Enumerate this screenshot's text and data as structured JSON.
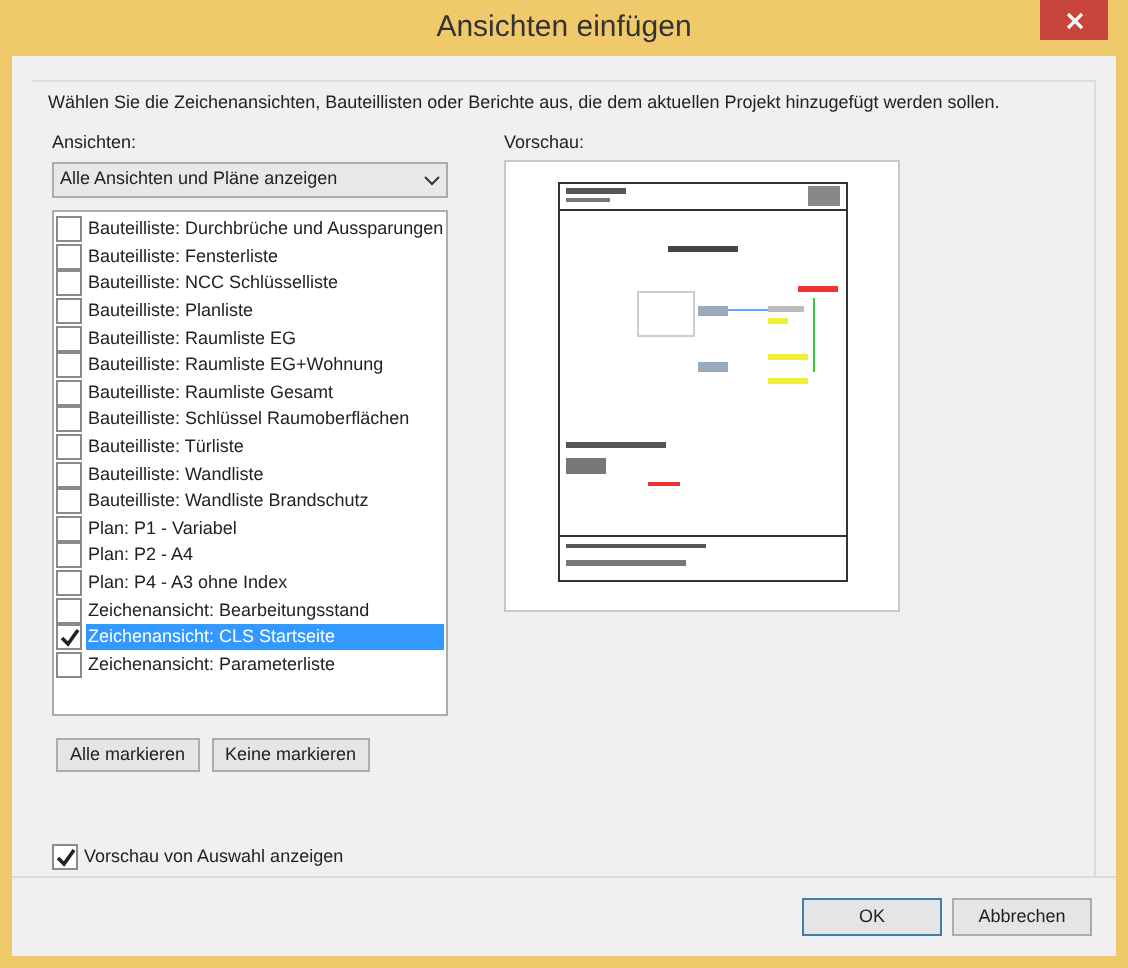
{
  "window": {
    "title": "Ansichten einfügen"
  },
  "instruction": "Wählen Sie die Zeichenansichten, Bauteillisten oder Berichte aus, die dem aktuellen Projekt hinzugefügt werden sollen.",
  "views_label": "Ansichten:",
  "filter": {
    "value": "Alle Ansichten und Pläne anzeigen"
  },
  "items": [
    {
      "label": "Bauteilliste: Durchbrüche und Aussparungen",
      "checked": false,
      "selected": false
    },
    {
      "label": "Bauteilliste: Fensterliste",
      "checked": false,
      "selected": false
    },
    {
      "label": "Bauteilliste: NCC Schlüsselliste",
      "checked": false,
      "selected": false
    },
    {
      "label": "Bauteilliste: Planliste",
      "checked": false,
      "selected": false
    },
    {
      "label": "Bauteilliste: Raumliste EG",
      "checked": false,
      "selected": false
    },
    {
      "label": "Bauteilliste: Raumliste EG+Wohnung",
      "checked": false,
      "selected": false
    },
    {
      "label": "Bauteilliste: Raumliste Gesamt",
      "checked": false,
      "selected": false
    },
    {
      "label": "Bauteilliste: Schlüssel Raumoberflächen",
      "checked": false,
      "selected": false
    },
    {
      "label": "Bauteilliste: Türliste",
      "checked": false,
      "selected": false
    },
    {
      "label": "Bauteilliste: Wandliste",
      "checked": false,
      "selected": false
    },
    {
      "label": "Bauteilliste: Wandliste Brandschutz",
      "checked": false,
      "selected": false
    },
    {
      "label": "Plan: P1 - Variabel",
      "checked": false,
      "selected": false
    },
    {
      "label": "Plan: P2 - A4",
      "checked": false,
      "selected": false
    },
    {
      "label": "Plan: P4 - A3 ohne Index",
      "checked": false,
      "selected": false
    },
    {
      "label": "Zeichenansicht: Bearbeitungsstand",
      "checked": false,
      "selected": false
    },
    {
      "label": "Zeichenansicht: CLS Startseite",
      "checked": true,
      "selected": true
    },
    {
      "label": "Zeichenansicht: Parameterliste",
      "checked": false,
      "selected": false
    }
  ],
  "list_buttons": [
    "Alle markieren",
    "Keine markieren"
  ],
  "preview_label": "Vorschau:",
  "show_preview": {
    "label": "Vorschau von Auswahl anzeigen",
    "checked": true
  },
  "buttons": [
    "OK",
    "Abbrechen"
  ]
}
